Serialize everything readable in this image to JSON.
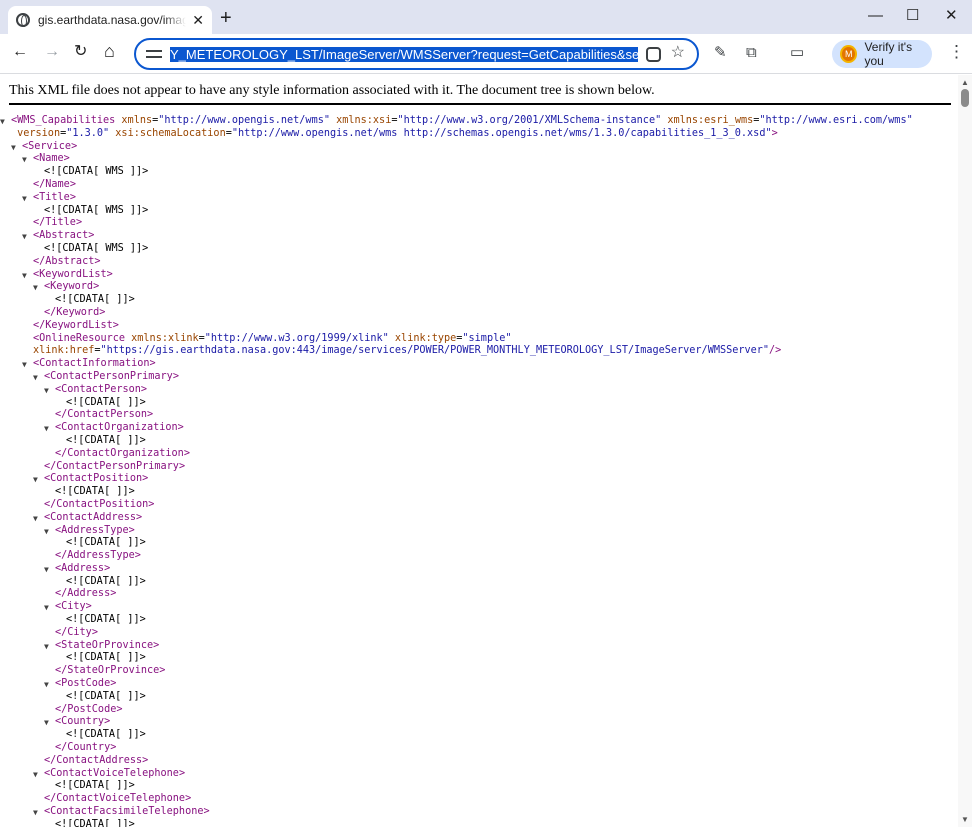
{
  "tab": {
    "title": "gis.earthdata.nasa.gov/image/se",
    "close": "✕",
    "new_tab": "+"
  },
  "window": {
    "minimize": "—",
    "maximize": "☐",
    "close": "✕"
  },
  "nav": {
    "back": "←",
    "forward": "→",
    "reload": "↻",
    "home": "⌂"
  },
  "omnibox": {
    "url": "Y_METEOROLOGY_LST/ImageServer/WMSServer?request=GetCapabilities&service=WMS",
    "star": "☆"
  },
  "toolbar_icons": {
    "pen": "✎",
    "extensions": "⧉",
    "sidepanel": "▭",
    "menu": "⋮"
  },
  "profile": {
    "initial": "M",
    "label": "Verify it's you"
  },
  "page": {
    "banner": "This XML file does not appear to have any style information associated with it. The document tree is shown below.",
    "lines": [
      {
        "i": 0,
        "t": true,
        "h": "<WMS_Capabilities xmlns=\"http://www.opengis.net/wms\" xmlns:xsi=\"http://www.w3.org/2001/XMLSchema-instance\" xmlns:esri_wms=\"http://www.esri.com/wms\""
      },
      {
        "i": 0,
        "t": false,
        "h": " version=\"1.3.0\" xsi:schemaLocation=\"http://www.opengis.net/wms http://schemas.opengis.net/wms/1.3.0/capabilities_1_3_0.xsd\">"
      },
      {
        "i": 1,
        "t": true,
        "h": "<Service>"
      },
      {
        "i": 2,
        "t": true,
        "h": "<Name>"
      },
      {
        "i": 3,
        "t": false,
        "h": "<![CDATA[ WMS ]]>"
      },
      {
        "i": 2,
        "t": false,
        "h": "</Name>"
      },
      {
        "i": 2,
        "t": true,
        "h": "<Title>"
      },
      {
        "i": 3,
        "t": false,
        "h": "<![CDATA[ WMS ]]>"
      },
      {
        "i": 2,
        "t": false,
        "h": "</Title>"
      },
      {
        "i": 2,
        "t": true,
        "h": "<Abstract>"
      },
      {
        "i": 3,
        "t": false,
        "h": "<![CDATA[ WMS ]]>"
      },
      {
        "i": 2,
        "t": false,
        "h": "</Abstract>"
      },
      {
        "i": 2,
        "t": true,
        "h": "<KeywordList>"
      },
      {
        "i": 3,
        "t": true,
        "h": "<Keyword>"
      },
      {
        "i": 4,
        "t": false,
        "h": "<![CDATA[ ]]>"
      },
      {
        "i": 3,
        "t": false,
        "h": "</Keyword>"
      },
      {
        "i": 2,
        "t": false,
        "h": "</KeywordList>"
      },
      {
        "i": 2,
        "t": false,
        "h": "<OnlineResource xmlns:xlink=\"http://www.w3.org/1999/xlink\" xlink:type=\"simple\""
      },
      {
        "i": 2,
        "t": false,
        "h": "xlink:href=\"https://gis.earthdata.nasa.gov:443/image/services/POWER/POWER_MONTHLY_METEOROLOGY_LST/ImageServer/WMSServer\"/>"
      },
      {
        "i": 2,
        "t": true,
        "h": "<ContactInformation>"
      },
      {
        "i": 3,
        "t": true,
        "h": "<ContactPersonPrimary>"
      },
      {
        "i": 4,
        "t": true,
        "h": "<ContactPerson>"
      },
      {
        "i": 5,
        "t": false,
        "h": "<![CDATA[ ]]>"
      },
      {
        "i": 4,
        "t": false,
        "h": "</ContactPerson>"
      },
      {
        "i": 4,
        "t": true,
        "h": "<ContactOrganization>"
      },
      {
        "i": 5,
        "t": false,
        "h": "<![CDATA[ ]]>"
      },
      {
        "i": 4,
        "t": false,
        "h": "</ContactOrganization>"
      },
      {
        "i": 3,
        "t": false,
        "h": "</ContactPersonPrimary>"
      },
      {
        "i": 3,
        "t": true,
        "h": "<ContactPosition>"
      },
      {
        "i": 4,
        "t": false,
        "h": "<![CDATA[ ]]>"
      },
      {
        "i": 3,
        "t": false,
        "h": "</ContactPosition>"
      },
      {
        "i": 3,
        "t": true,
        "h": "<ContactAddress>"
      },
      {
        "i": 4,
        "t": true,
        "h": "<AddressType>"
      },
      {
        "i": 5,
        "t": false,
        "h": "<![CDATA[ ]]>"
      },
      {
        "i": 4,
        "t": false,
        "h": "</AddressType>"
      },
      {
        "i": 4,
        "t": true,
        "h": "<Address>"
      },
      {
        "i": 5,
        "t": false,
        "h": "<![CDATA[ ]]>"
      },
      {
        "i": 4,
        "t": false,
        "h": "</Address>"
      },
      {
        "i": 4,
        "t": true,
        "h": "<City>"
      },
      {
        "i": 5,
        "t": false,
        "h": "<![CDATA[ ]]>"
      },
      {
        "i": 4,
        "t": false,
        "h": "</City>"
      },
      {
        "i": 4,
        "t": true,
        "h": "<StateOrProvince>"
      },
      {
        "i": 5,
        "t": false,
        "h": "<![CDATA[ ]]>"
      },
      {
        "i": 4,
        "t": false,
        "h": "</StateOrProvince>"
      },
      {
        "i": 4,
        "t": true,
        "h": "<PostCode>"
      },
      {
        "i": 5,
        "t": false,
        "h": "<![CDATA[ ]]>"
      },
      {
        "i": 4,
        "t": false,
        "h": "</PostCode>"
      },
      {
        "i": 4,
        "t": true,
        "h": "<Country>"
      },
      {
        "i": 5,
        "t": false,
        "h": "<![CDATA[ ]]>"
      },
      {
        "i": 4,
        "t": false,
        "h": "</Country>"
      },
      {
        "i": 3,
        "t": false,
        "h": "</ContactAddress>"
      },
      {
        "i": 3,
        "t": true,
        "h": "<ContactVoiceTelephone>"
      },
      {
        "i": 4,
        "t": false,
        "h": "<![CDATA[ ]]>"
      },
      {
        "i": 3,
        "t": false,
        "h": "</ContactVoiceTelephone>"
      },
      {
        "i": 3,
        "t": true,
        "h": "<ContactFacsimileTelephone>"
      },
      {
        "i": 4,
        "t": false,
        "h": "<![CDATA[ ]]>"
      }
    ]
  },
  "scrollbar": {
    "up": "▲",
    "down": "▼"
  },
  "colors": {
    "tag": "#881280",
    "attr_name": "#994500",
    "attr_value": "#1a1aa6",
    "accent": "#0b57d0"
  }
}
